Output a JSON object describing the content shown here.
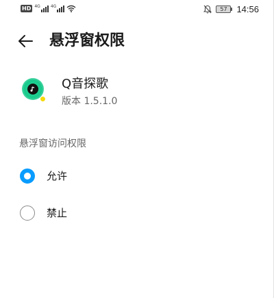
{
  "status_bar": {
    "hd_badge": "HD",
    "signal_label_1": "4G",
    "signal_label_2": "4G",
    "battery_level": "57",
    "time": "14:56"
  },
  "header": {
    "title": "悬浮窗权限"
  },
  "app": {
    "name": "Q音探歌",
    "version": "版本 1.5.1.0"
  },
  "permission": {
    "section_label": "悬浮窗访问权限",
    "options": [
      {
        "label": "允许",
        "selected": true
      },
      {
        "label": "禁止",
        "selected": false
      }
    ]
  },
  "colors": {
    "accent": "#0a9cff",
    "app_icon": "#18c88b"
  }
}
